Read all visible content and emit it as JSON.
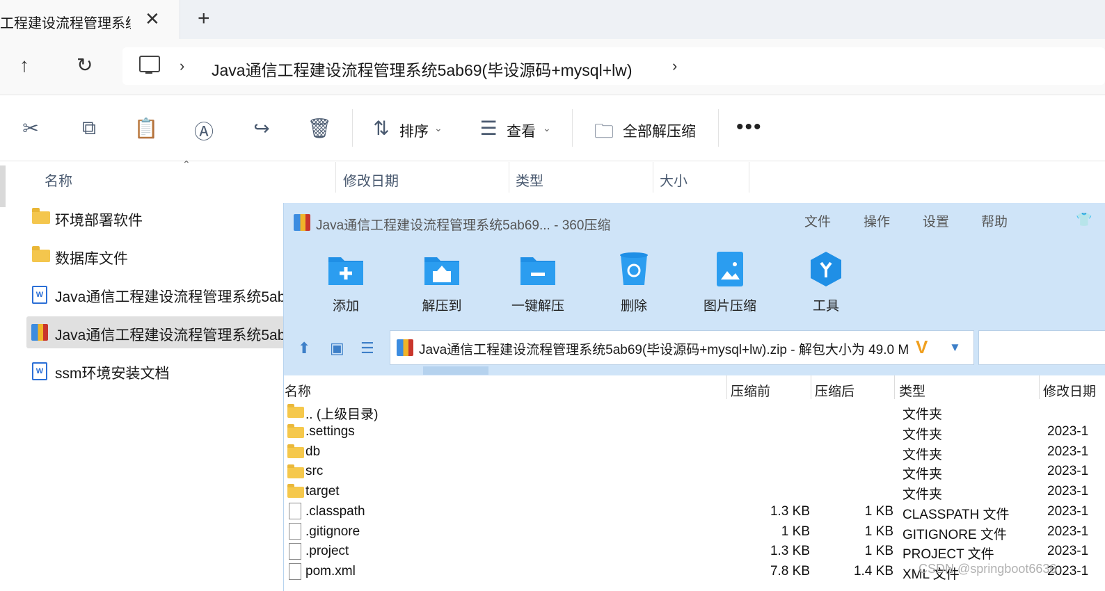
{
  "tab": {
    "title": "工程建设流程管理系统",
    "close": "✕",
    "new": "+"
  },
  "address": {
    "crumb": "Java通信工程建设流程管理系统5ab69(毕设源码+mysql+lw)",
    "sep": "›"
  },
  "commandbar": {
    "sort_label": "排序",
    "view_label": "查看",
    "extract_all_label": "全部解压缩",
    "more": "•••"
  },
  "explorer": {
    "columns": [
      "名称",
      "修改日期",
      "类型",
      "大小"
    ],
    "rows": [
      {
        "label": "环境部署软件",
        "icon": "folder-icon"
      },
      {
        "label": "数据库文件",
        "icon": "folder-icon"
      },
      {
        "label": "Java通信工程建设流程管理系统5ab",
        "icon": "word-doc-icon"
      },
      {
        "label": "Java通信工程建设流程管理系统5ab",
        "icon": "zip-archive-icon",
        "selected": true
      },
      {
        "label": "ssm环境安装文档",
        "icon": "word-doc-icon"
      }
    ]
  },
  "zip": {
    "title": "Java通信工程建设流程管理系统5ab69... - 360压缩",
    "menu": [
      "文件",
      "操作",
      "设置",
      "帮助"
    ],
    "tools": [
      "添加",
      "解压到",
      "一键解压",
      "删除",
      "图片压缩",
      "工具"
    ],
    "path": "Java通信工程建设流程管理系统5ab69(毕设源码+mysql+lw).zip - 解包大小为 49.0 M",
    "columns": [
      "名称",
      "压缩前",
      "压缩后",
      "类型",
      "修改日期"
    ],
    "rows": [
      {
        "name": ".. (上级目录)",
        "before": "",
        "after": "",
        "type": "文件夹",
        "date": "",
        "kind": "folder"
      },
      {
        "name": ".settings",
        "before": "",
        "after": "",
        "type": "文件夹",
        "date": "2023-1",
        "kind": "folder"
      },
      {
        "name": "db",
        "before": "",
        "after": "",
        "type": "文件夹",
        "date": "2023-1",
        "kind": "folder"
      },
      {
        "name": "src",
        "before": "",
        "after": "",
        "type": "文件夹",
        "date": "2023-1",
        "kind": "folder"
      },
      {
        "name": "target",
        "before": "",
        "after": "",
        "type": "文件夹",
        "date": "2023-1",
        "kind": "folder"
      },
      {
        "name": ".classpath",
        "before": "1.3 KB",
        "after": "1 KB",
        "type": "CLASSPATH 文件",
        "date": "2023-1",
        "kind": "file"
      },
      {
        "name": ".gitignore",
        "before": "1 KB",
        "after": "1 KB",
        "type": "GITIGNORE 文件",
        "date": "2023-1",
        "kind": "file"
      },
      {
        "name": ".project",
        "before": "1.3 KB",
        "after": "1 KB",
        "type": "PROJECT 文件",
        "date": "2023-1",
        "kind": "file"
      },
      {
        "name": "pom.xml",
        "before": "7.8 KB",
        "after": "1.4 KB",
        "type": "XML 文件",
        "date": "2023-1",
        "kind": "file"
      }
    ],
    "watermark": "CSDN @springboot6636"
  },
  "colors": {
    "zip_header_bg": "#cfe4f8",
    "folder": "#f4c64d",
    "accent_blue": "#2b8ae0"
  }
}
